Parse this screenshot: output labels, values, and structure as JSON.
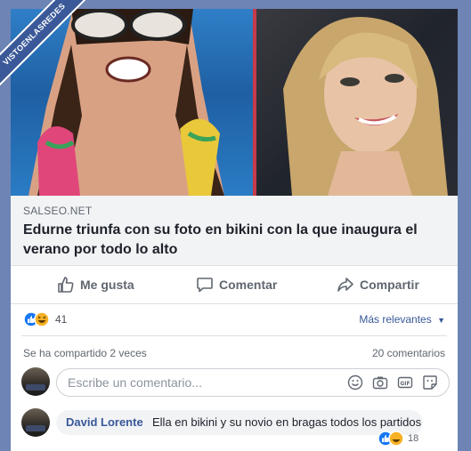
{
  "watermark": "VISTOENLASREDES",
  "link": {
    "source": "SALSEO.NET",
    "title": "Edurne triunfa con su foto en bikini con la que inaugura el verano por todo lo alto"
  },
  "actions": {
    "like": "Me gusta",
    "comment": "Comentar",
    "share": "Compartir"
  },
  "reactions": {
    "count": "41",
    "relevant": "Más relevantes"
  },
  "stats": {
    "shared": "Se ha compartido 2 veces",
    "comments": "20 comentarios"
  },
  "composer": {
    "placeholder": "Escribe un comentario..."
  },
  "comment": {
    "author": "David Lorente",
    "text": "Ella en bikini y su novio en bragas todos los partidos",
    "reaction_count": "18"
  },
  "colors": {
    "link": "#385898",
    "like_blue": "#1877f2",
    "haha_yellow": "#f7b125"
  }
}
